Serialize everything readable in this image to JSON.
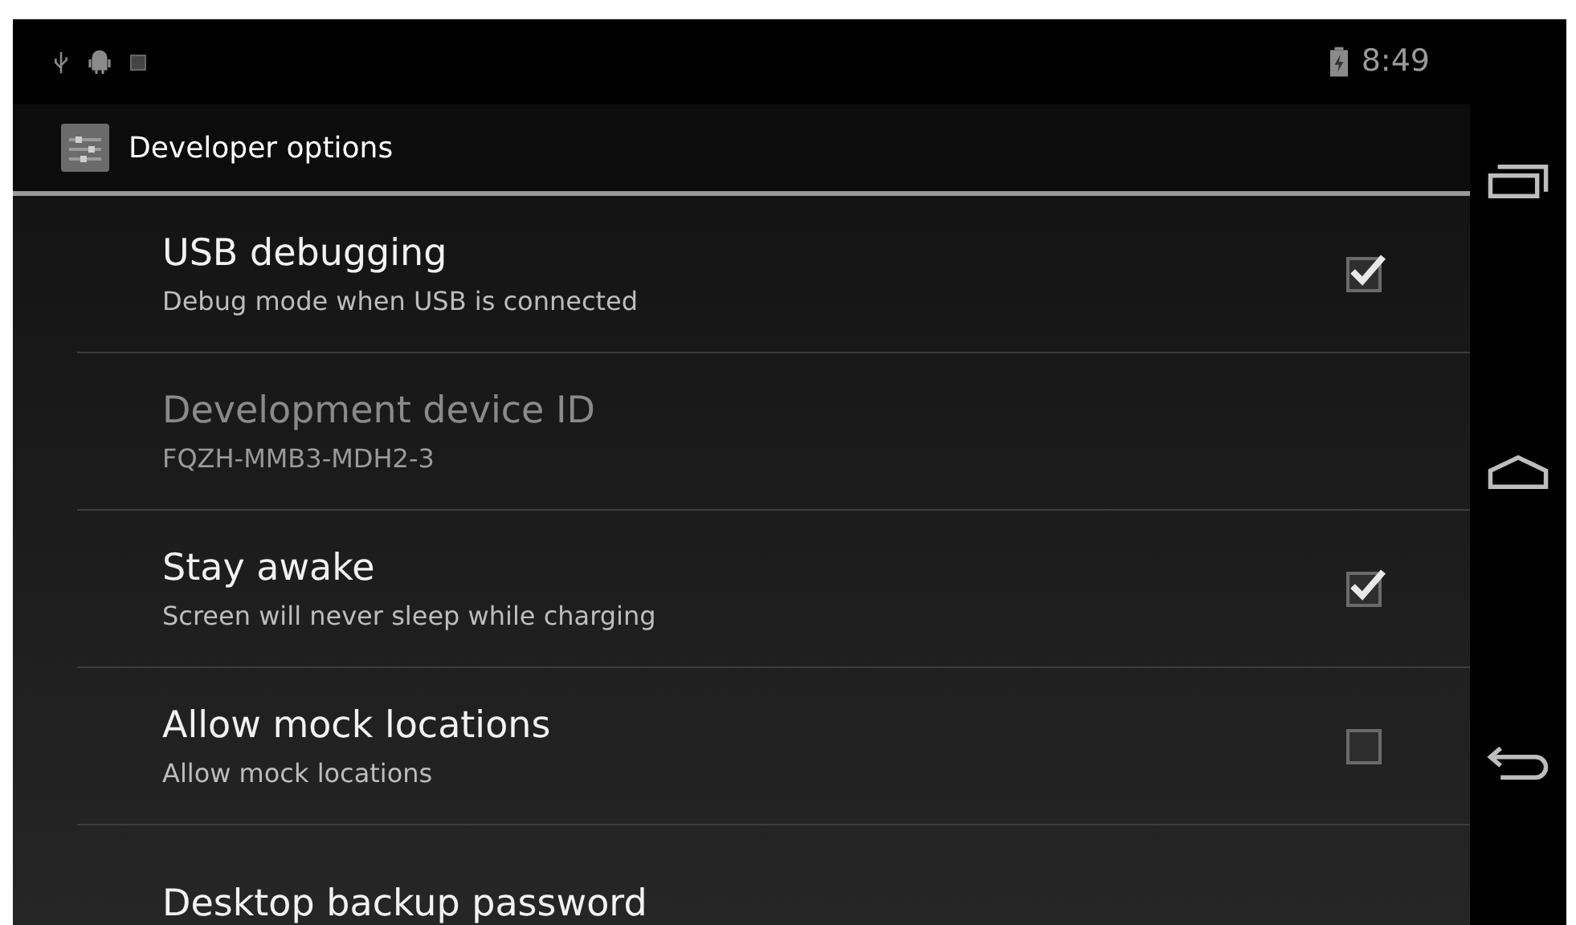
{
  "status_bar": {
    "time": "8:49"
  },
  "action_bar": {
    "title": "Developer options"
  },
  "settings": [
    {
      "kind": "checkbox",
      "title": "USB debugging",
      "summary": "Debug mode when USB is connected",
      "checked": true,
      "disabled": false
    },
    {
      "kind": "info",
      "title": "Development device ID",
      "summary": "FQZH-MMB3-MDH2-3",
      "disabled": true
    },
    {
      "kind": "checkbox",
      "title": "Stay awake",
      "summary": "Screen will never sleep while charging",
      "checked": true,
      "disabled": false
    },
    {
      "kind": "checkbox",
      "title": "Allow mock locations",
      "summary": "Allow mock locations",
      "checked": false,
      "disabled": false
    },
    {
      "kind": "info",
      "title": "Desktop backup password",
      "disabled": false
    }
  ]
}
